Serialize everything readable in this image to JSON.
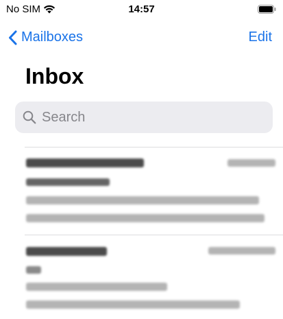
{
  "status_bar": {
    "carrier": "No SIM",
    "time": "14:57"
  },
  "nav": {
    "back_label": "Mailboxes",
    "edit_label": "Edit"
  },
  "page_title": "Inbox",
  "search": {
    "placeholder": "Search"
  },
  "colors": {
    "accent": "#1a73e8",
    "search_bg": "#ececf0",
    "placeholder": "#86868b"
  },
  "icons": [
    "wifi-icon",
    "battery-icon",
    "chevron-left-icon",
    "search-icon"
  ]
}
